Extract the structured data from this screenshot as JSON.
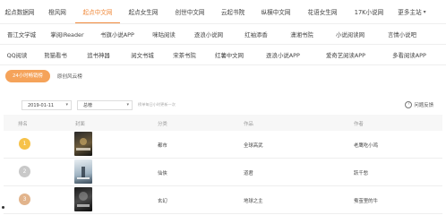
{
  "nav_primary": [
    "起点数据网",
    "橙风网",
    "起点中文网",
    "起点女生网",
    "创世中文网",
    "云起书院",
    "纵横中文网",
    "花语女生网",
    "17K小说网",
    "更多主站"
  ],
  "nav_primary_active": "起点中文网",
  "nav_secondary": [
    "晋江文学城",
    "掌阅iReader",
    "书旗小说APP",
    "咪咕阅读",
    "逐浪小说网",
    "红袖添香",
    "潇湘书院",
    "小说阅读网",
    "言情小说吧"
  ],
  "nav_tertiary": [
    "QQ阅读",
    "熊猫看书",
    "追书神器",
    "阅文书城",
    "宋茶书院",
    "红薯中文网",
    "逐浪小说APP",
    "爱奇艺阅读APP",
    "多看阅读APP"
  ],
  "pills": {
    "active": "24小时畅销榜",
    "other": "原创风云榜"
  },
  "filter": {
    "date": "2019-01-11",
    "category": "总榜",
    "hint": "榜单每日小时更新一次",
    "feedback": "问题反馈"
  },
  "table": {
    "headers": {
      "rank": "排名",
      "cover": "封面",
      "category": "分类",
      "title": "作品",
      "author": "作者"
    },
    "rows": [
      {
        "rank": "1",
        "category": "都市",
        "title": "全球高武",
        "author": "老鹰吃小鸡",
        "medal_color": "#f6c24a",
        "cover_text": "全球高武"
      },
      {
        "rank": "2",
        "category": "仙侠",
        "title": "道君",
        "author": "跃千愁",
        "medal_color": "#c9c9c9",
        "cover_text": "道君"
      },
      {
        "rank": "3",
        "category": "玄幻",
        "title": "地球之主",
        "author": "蚕茧里的牛",
        "medal_color": "#e2b48c",
        "cover_text": "地球之主"
      }
    ]
  },
  "icons": {
    "more": "chevron-down-icon",
    "caret": "caret-down-icon",
    "feedback": "question-circle-icon"
  },
  "colors": {
    "accent": "#f08a3c",
    "pill": "#f5a35a"
  }
}
